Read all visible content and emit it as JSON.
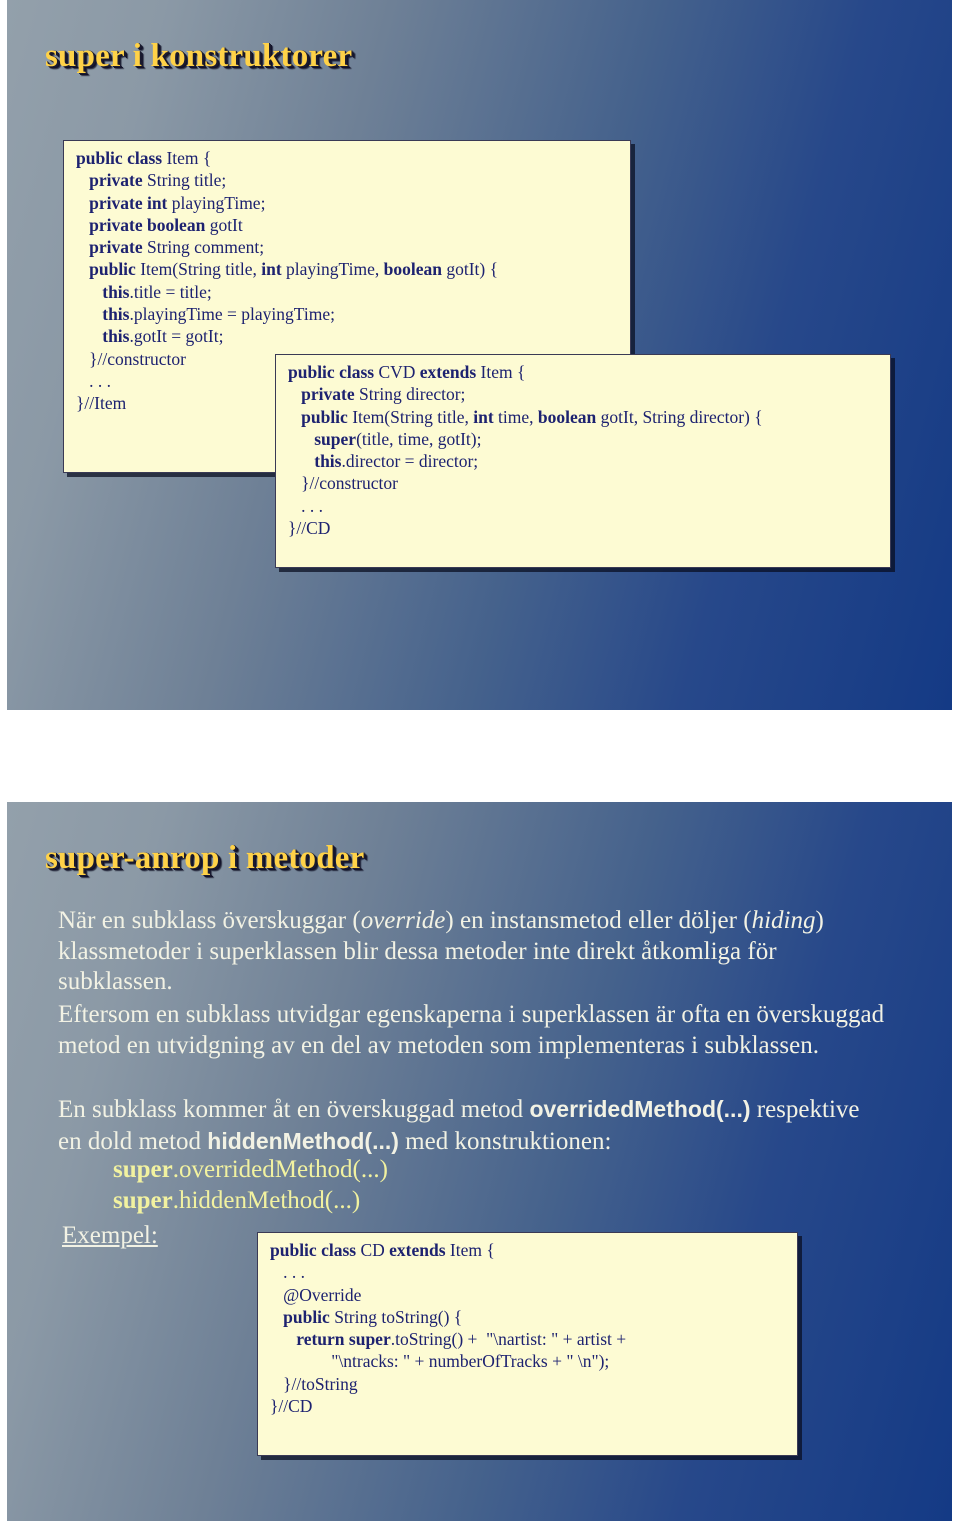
{
  "slides": [
    {
      "title": "super i konstruktorer",
      "code_blocks": [
        {
          "name": "item-class",
          "lines": [
            [
              {
                "t": "public class ",
                "b": true
              },
              {
                "t": "Item {",
                "b": false
              }
            ],
            [
              {
                "t": "   private ",
                "b": true
              },
              {
                "t": "String title;",
                "b": false
              }
            ],
            [
              {
                "t": "   private int ",
                "b": true
              },
              {
                "t": "playingTime;",
                "b": false
              }
            ],
            [
              {
                "t": "   private boolean ",
                "b": true
              },
              {
                "t": "gotIt",
                "b": false
              }
            ],
            [
              {
                "t": "   private ",
                "b": true
              },
              {
                "t": "String comment;",
                "b": false
              }
            ],
            [
              {
                "t": "   public ",
                "b": true
              },
              {
                "t": "Item(String title, ",
                "b": false
              },
              {
                "t": "int ",
                "b": true
              },
              {
                "t": "playingTime, ",
                "b": false
              },
              {
                "t": "boolean ",
                "b": true
              },
              {
                "t": "gotIt) {",
                "b": false
              }
            ],
            [
              {
                "t": "      this",
                "b": true
              },
              {
                "t": ".title = title;",
                "b": false
              }
            ],
            [
              {
                "t": "      this",
                "b": true
              },
              {
                "t": ".playingTime = playingTime;",
                "b": false
              }
            ],
            [
              {
                "t": "      this",
                "b": true
              },
              {
                "t": ".gotIt = gotIt;",
                "b": false
              }
            ],
            [
              {
                "t": "   }//constructor",
                "b": false
              }
            ],
            [
              {
                "t": "   . . .",
                "b": false
              }
            ],
            [
              {
                "t": "}//Item",
                "b": false
              }
            ]
          ]
        },
        {
          "name": "cvd-class",
          "lines": [
            [
              {
                "t": "public class ",
                "b": true
              },
              {
                "t": "CVD ",
                "b": false
              },
              {
                "t": "extends ",
                "b": true
              },
              {
                "t": "Item {",
                "b": false
              }
            ],
            [
              {
                "t": "   private ",
                "b": true
              },
              {
                "t": "String director;",
                "b": false
              }
            ],
            [
              {
                "t": "   public ",
                "b": true
              },
              {
                "t": "Item(String title, ",
                "b": false
              },
              {
                "t": "int ",
                "b": true
              },
              {
                "t": "time, ",
                "b": false
              },
              {
                "t": "boolean ",
                "b": true
              },
              {
                "t": "gotIt, String director) {",
                "b": false
              }
            ],
            [
              {
                "t": "      super",
                "b": true
              },
              {
                "t": "(title, time, gotIt);",
                "b": false
              }
            ],
            [
              {
                "t": "      this",
                "b": true
              },
              {
                "t": ".director = director;",
                "b": false
              }
            ],
            [
              {
                "t": "   }//constructor",
                "b": false
              }
            ],
            [
              {
                "t": "   . . .",
                "b": false
              }
            ],
            [
              {
                "t": "}//CD",
                "b": false
              }
            ]
          ]
        }
      ]
    },
    {
      "title": "super-anrop i metoder",
      "paragraphs": [
        {
          "name": "paragraph-override-hiding",
          "runs": [
            {
              "t": "När en subklass överskuggar (",
              "style": "normal"
            },
            {
              "t": "override",
              "style": "italic"
            },
            {
              "t": ") en instansmetod eller döljer (",
              "style": "normal"
            },
            {
              "t": "hiding",
              "style": "italic"
            },
            {
              "t": ") klassmetoder i superklassen blir dessa metoder inte direkt åtkomliga för subklassen.",
              "style": "normal"
            }
          ]
        },
        {
          "name": "paragraph-subclass-extends",
          "runs": [
            {
              "t": "Eftersom en subklass utvidgar egenskaperna i superklassen är ofta en överskuggad metod en utvidgning av en del av metoden som implementeras i subklassen.",
              "style": "normal"
            }
          ]
        },
        {
          "name": "paragraph-access-overridden",
          "runs": [
            {
              "t": "En subklass kommer åt en överskuggad metod ",
              "style": "normal"
            },
            {
              "t": "overridedMethod(...)",
              "style": "mono"
            },
            {
              "t": " respektive en dold metod ",
              "style": "normal"
            },
            {
              "t": "hiddenMethod(...)",
              "style": "mono"
            },
            {
              "t": " med konstruktionen:",
              "style": "normal"
            }
          ]
        }
      ],
      "super_calls": [
        {
          "bold": "super",
          "rest": ".overridedMethod(...)"
        },
        {
          "bold": "super",
          "rest": ".hiddenMethod(...)"
        }
      ],
      "example_label": "Exempel:",
      "code_blocks": [
        {
          "name": "cd-tostring-class",
          "lines": [
            [
              {
                "t": "public class ",
                "b": true
              },
              {
                "t": "CD ",
                "b": false
              },
              {
                "t": "extends ",
                "b": true
              },
              {
                "t": "Item {",
                "b": false
              }
            ],
            [
              {
                "t": "   . . .",
                "b": false
              }
            ],
            [
              {
                "t": "   @Override",
                "b": false
              }
            ],
            [
              {
                "t": "   public ",
                "b": true
              },
              {
                "t": "String toString() {",
                "b": false
              }
            ],
            [
              {
                "t": "      return super",
                "b": true
              },
              {
                "t": ".toString() +  \"\\nartist: \" + artist +",
                "b": false
              }
            ],
            [
              {
                "t": "              \"\\ntracks: \" + numberOfTracks + \" \\n\");",
                "b": false
              }
            ],
            [
              {
                "t": "   }//toString",
                "b": false
              }
            ],
            [
              {
                "t": "}//CD",
                "b": false
              }
            ]
          ]
        }
      ]
    }
  ],
  "colors": {
    "title_yellow": "#ffd248",
    "code_bg": "#fdfbd3",
    "code_text": "#1d2270",
    "body_text": "#f2f2e4",
    "super_call_text": "#f2f2a0",
    "slide_bg_start": "#93a0ab",
    "slide_bg_end": "#143a85"
  }
}
